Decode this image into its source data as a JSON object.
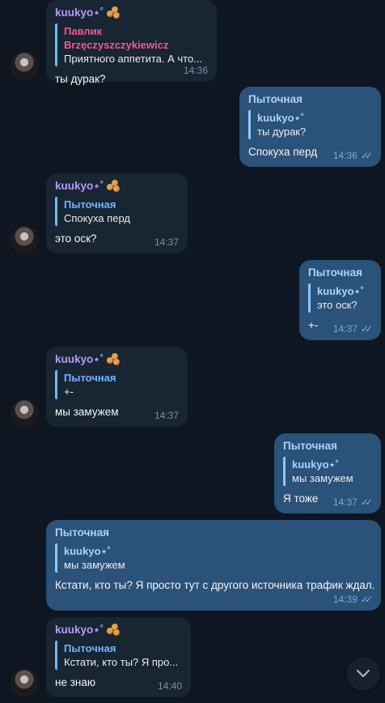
{
  "colors": {
    "background": "#0e1621",
    "incoming": "#182533",
    "outgoing": "#2b5278",
    "sender_purple": "#b49cf0",
    "sender_blue": "#6fb7ff",
    "quote_pink": "#f05c8c",
    "check": "#5fb5ff"
  },
  "messages": [
    {
      "sender": "kuukyo⋆˚",
      "reply_name": "Павлик Brzęczyszczykiewicz",
      "reply_text": "Приятного аппетита. А что...",
      "text": "ты дурак?",
      "time": "14:36"
    },
    {
      "sender": "Пыточная",
      "reply_name": "kuukyo⋆˚",
      "reply_text": "ты дурак?",
      "text": "Спокуха перд",
      "time": "14:36"
    },
    {
      "sender": "kuukyo⋆˚",
      "reply_name": "Пыточная",
      "reply_text": "Спокуха перд",
      "text": "это оск?",
      "time": "14:37"
    },
    {
      "sender": "Пыточная",
      "reply_name": "kuukyo⋆˚",
      "reply_text": "это оск?",
      "text": "+-",
      "time": "14:37"
    },
    {
      "sender": "kuukyo⋆˚",
      "reply_name": "Пыточная",
      "reply_text": "+-",
      "text": "мы замужем",
      "time": "14:37"
    },
    {
      "sender": "Пыточная",
      "reply_name": "kuukyo⋆˚",
      "reply_text": "мы замужем",
      "text": "Я тоже",
      "time": "14:37"
    },
    {
      "sender": "Пыточная",
      "reply_name": "kuukyo⋆˚",
      "reply_text": "мы замужем",
      "text": "Кстати, кто ты? Я просто тут с другого источника трафик ждал.",
      "time": "14:39"
    },
    {
      "sender": "kuukyo⋆˚",
      "reply_name": "Пыточная",
      "reply_text": "Кстати, кто ты? Я про...",
      "text": "не знаю",
      "time": "14:40"
    }
  ],
  "scroll_button": {
    "icon": "chevron-down-icon"
  }
}
